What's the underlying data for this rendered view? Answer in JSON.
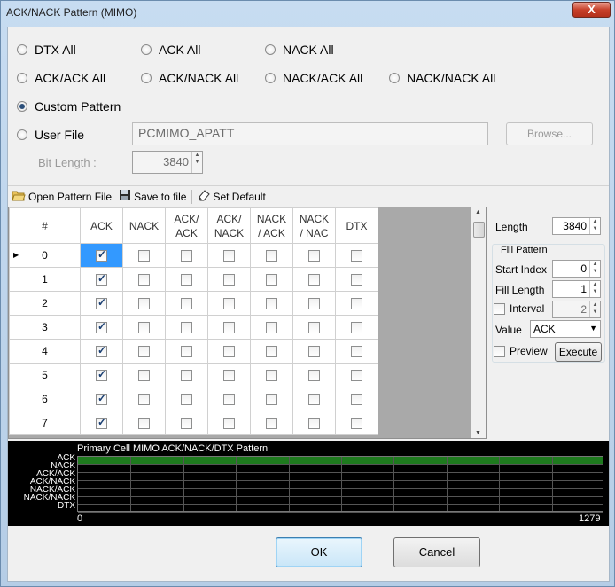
{
  "window": {
    "title": "ACK/NACK Pattern (MIMO)",
    "close_glyph": "X"
  },
  "radios": [
    {
      "label": "DTX All",
      "checked": false
    },
    {
      "label": "ACK All",
      "checked": false
    },
    {
      "label": "NACK All",
      "checked": false
    },
    {
      "label": "ACK/ACK All",
      "checked": false
    },
    {
      "label": "ACK/NACK All",
      "checked": false
    },
    {
      "label": "NACK/ACK All",
      "checked": false
    },
    {
      "label": "NACK/NACK All",
      "checked": false
    },
    {
      "label": "Custom Pattern",
      "checked": true
    },
    {
      "label": "User File",
      "checked": false
    }
  ],
  "user_file": {
    "value": "PCMIMO_APATT",
    "browse_label": "Browse..."
  },
  "bit_length": {
    "label": "Bit Length :",
    "value": "3840"
  },
  "toolbar": {
    "open_label": "Open Pattern File",
    "save_label": "Save to file",
    "default_label": "Set Default"
  },
  "grid": {
    "headers": [
      "#",
      "ACK",
      "NACK",
      "ACK/\nACK",
      "ACK/\nNACK",
      "NACK\n/ ACK",
      "NACK\n/ NAC",
      "DTX"
    ],
    "rows": [
      {
        "index": "0",
        "ack": true
      },
      {
        "index": "1",
        "ack": true
      },
      {
        "index": "2",
        "ack": true
      },
      {
        "index": "3",
        "ack": true
      },
      {
        "index": "4",
        "ack": true
      },
      {
        "index": "5",
        "ack": true
      },
      {
        "index": "6",
        "ack": true
      },
      {
        "index": "7",
        "ack": true
      }
    ]
  },
  "panel": {
    "length_label": "Length",
    "length_value": "3840",
    "fill_pattern_label": "Fill Pattern",
    "start_index_label": "Start Index",
    "start_index_value": "0",
    "fill_length_label": "Fill Length",
    "fill_length_value": "1",
    "interval_label": "Interval",
    "interval_value": "2",
    "value_label": "Value",
    "value_selected": "ACK",
    "preview_label": "Preview",
    "execute_label": "Execute"
  },
  "pattern_view": {
    "title": "Primary Cell MIMO ACK/NACK/DTX Pattern",
    "row_labels": [
      "ACK",
      "NACK",
      "ACK/ACK",
      "ACK/NACK",
      "NACK/ACK",
      "NACK/NACK",
      "DTX"
    ],
    "x_start": "0",
    "x_end": "1279",
    "ack_color": "#1e7a1e"
  },
  "footer": {
    "ok_label": "OK",
    "cancel_label": "Cancel"
  }
}
